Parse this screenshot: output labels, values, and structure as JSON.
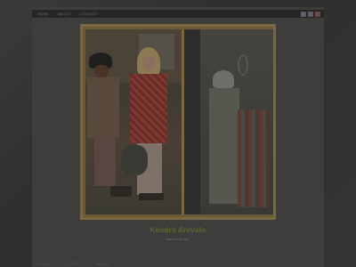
{
  "nav": {
    "items": [
      "HOME",
      "ABOUT",
      "CONTACT"
    ]
  },
  "social": {
    "icons": [
      {
        "name": "social-icon-1",
        "color": "#5a6270"
      },
      {
        "name": "social-icon-2",
        "color": "#5a5f6a"
      },
      {
        "name": "social-icon-3",
        "color": "#6a4a4a"
      }
    ]
  },
  "photo": {
    "caption_title": "Kendra Arevalo",
    "caption_sub": "fashion & style"
  },
  "footer": {
    "items": [
      "DESIGN",
      "POSTS",
      "ARCHIVE"
    ]
  }
}
